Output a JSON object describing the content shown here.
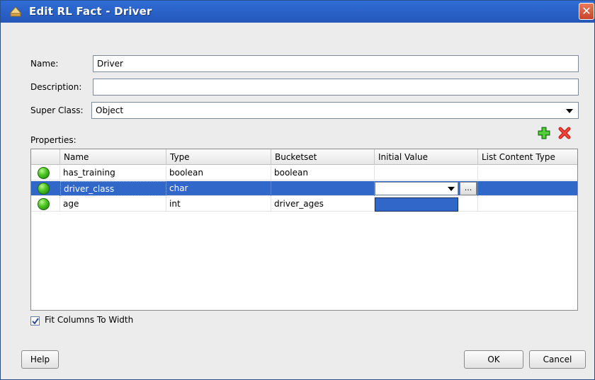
{
  "window": {
    "title": "Edit RL Fact - Driver",
    "close_glyph": "✕"
  },
  "form": {
    "name_label": "Name:",
    "name_value": "Driver",
    "description_label": "Description:",
    "description_value": "",
    "superclass_label": "Super Class:",
    "superclass_value": "Object",
    "properties_label": "Properties:"
  },
  "toolbar": {
    "add_icon": "plus-icon",
    "delete_icon": "delete-x-icon"
  },
  "table": {
    "columns": [
      "Name",
      "Type",
      "Bucketset",
      "Initial Value",
      "List Content Type"
    ],
    "rows": [
      {
        "name": "has_training",
        "type": "boolean",
        "bucketset": "boolean",
        "initial_value": "",
        "list_content_type": ""
      },
      {
        "name": "driver_class",
        "type": "char",
        "bucketset": "",
        "initial_value": "",
        "list_content_type": ""
      },
      {
        "name": "age",
        "type": "int",
        "bucketset": "driver_ages",
        "initial_value": "",
        "list_content_type": ""
      }
    ],
    "selected_row": 1,
    "ellipsis_label": "..."
  },
  "options": {
    "fit_columns_label": "Fit Columns To Width",
    "fit_columns_checked": true
  },
  "buttons": {
    "help": "Help",
    "ok": "OK",
    "cancel": "Cancel"
  }
}
